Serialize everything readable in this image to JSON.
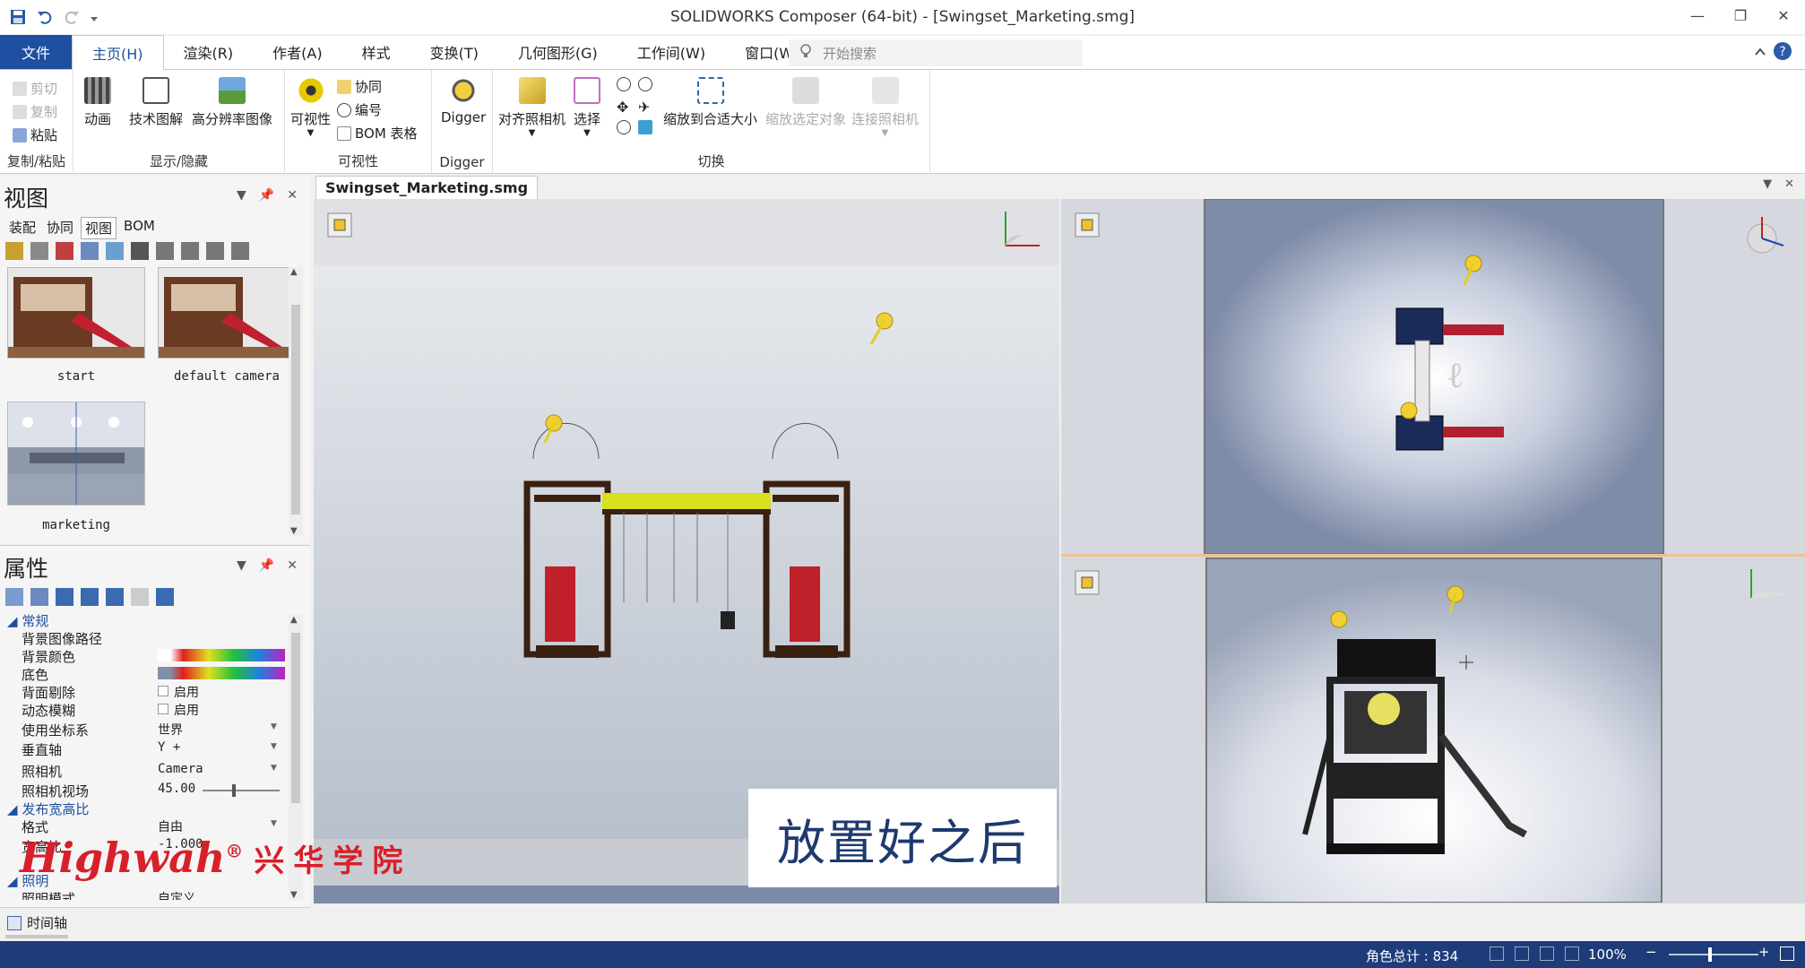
{
  "window": {
    "title": "SOLIDWORKS Composer (64-bit) - [Swingset_Marketing.smg]"
  },
  "menu": {
    "file": "文件",
    "tabs": [
      "主页(H)",
      "渲染(R)",
      "作者(A)",
      "样式",
      "变换(T)",
      "几何图形(G)",
      "工作间(W)",
      "窗口(W)"
    ],
    "search_placeholder": "开始搜索"
  },
  "ribbon": {
    "clipboard": {
      "cut": "剪切",
      "copy": "复制",
      "paste": "粘贴",
      "label": "复制/粘贴"
    },
    "show_hide": {
      "animation": "动画",
      "tech_illustration": "技术图解",
      "hires_image": "高分辨率图像",
      "label": "显示/隐藏"
    },
    "visibility": {
      "visibility": "可视性",
      "collab": "协同",
      "numbering": "编号",
      "bom_table": "BOM 表格",
      "label": "可视性"
    },
    "digger": {
      "digger": "Digger",
      "label": "Digger"
    },
    "switch": {
      "align_camera": "对齐照相机",
      "select": "选择",
      "zoom_fit": "缩放到合适大小",
      "zoom_selected": "缩放选定对象",
      "link_camera": "连接照相机",
      "label": "切换"
    }
  },
  "views_panel": {
    "title": "视图",
    "tabs": [
      "装配",
      "协同",
      "视图",
      "BOM"
    ],
    "active_tab": "视图",
    "views": [
      {
        "name": "start"
      },
      {
        "name": "default camera"
      },
      {
        "name": "marketing"
      }
    ]
  },
  "properties_panel": {
    "title": "属性",
    "section_general": "常规",
    "rows": [
      {
        "key": "背景图像路径",
        "value": ""
      },
      {
        "key": "背景颜色",
        "value": ""
      },
      {
        "key": "底色",
        "value": ""
      },
      {
        "key": "背面剔除",
        "value": "启用"
      },
      {
        "key": "动态模糊",
        "value": "启用"
      },
      {
        "key": "使用坐标系",
        "value": "世界"
      },
      {
        "key": "垂直轴",
        "value": "Y +"
      },
      {
        "key": "照相机",
        "value": "Camera"
      },
      {
        "key": "照相机视场",
        "value": "45.00"
      }
    ],
    "section_aspect": "发布宽高比",
    "rows2": [
      {
        "key": "格式",
        "value": "自由"
      },
      {
        "key": "宽高比",
        "value": "-1.000"
      }
    ],
    "section_lighting": "照明",
    "rows3": [
      {
        "key": "照明模式",
        "value": "自定义"
      }
    ],
    "fov_value": 0.4
  },
  "timeline": {
    "label": "时间轴"
  },
  "document": {
    "tab": "Swingset_Marketing.smg"
  },
  "overlay": {
    "watermark_en": "Highwah",
    "watermark_reg": "®",
    "watermark_cn": "兴华学院",
    "caption": "放置好之后"
  },
  "status": {
    "actors_label": "角色总计 : 834",
    "zoom": "100%"
  },
  "colors": {
    "accent": "#1e4fa0",
    "status": "#1e3c7a",
    "watermark": "#d8202a"
  }
}
